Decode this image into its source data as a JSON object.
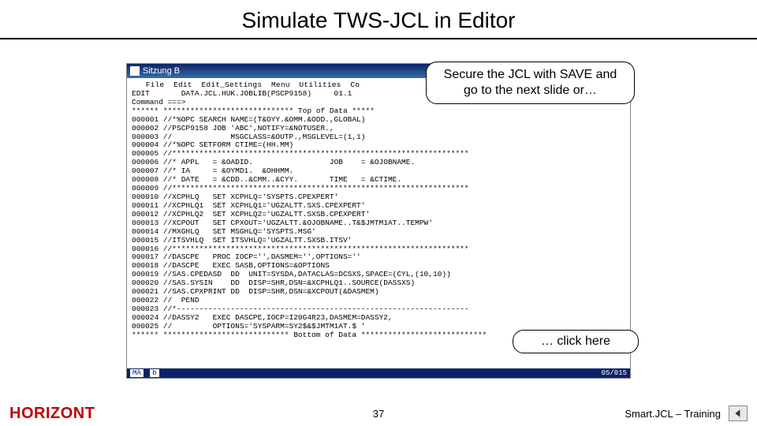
{
  "slide": {
    "title": "Simulate TWS-JCL in Editor",
    "page_number": "37",
    "brand": "HORIZONT",
    "course": "Smart.JCL – Training"
  },
  "callouts": {
    "c1": "Secure the JCL with SAVE and go to the next slide or…",
    "c2": "… click here"
  },
  "terminal": {
    "window_title": "Sitzung B",
    "menu": "   File  Edit  Edit_Settings  Menu  Utilities  Co",
    "header1": "EDIT       DATA.JCL.HUK.JOBLIB(PSCP9158)     01.1",
    "header2": "Command ===>",
    "lines": [
      "****** ***************************** Top of Data *****",
      "000001 //*%OPC SEARCH NAME=(T&OYY.&OMM.&ODD.,GLOBAL)",
      "000002 //PSCP9158 JOB 'ABC',NOTIFY=&NOTUSER.,",
      "000003 //             MSGCLASS=&OUTP.,MSGLEVEL=(1,1)",
      "000004 //*%OPC SETFORM CTIME=(HH.MM)",
      "000005 //******************************************************************",
      "000006 //* APPL   = &OADID.                 JOB    = &OJOBNAME.",
      "000007 //* IA     = &OYMD1.  &OHHMM.",
      "000008 //* DATE   = &CDD..&CMM..&CYY.       TIME   = &CTIME.",
      "000009 //******************************************************************",
      "000010 //XCPHLQ   SET XCPHLQ='SYSPTS.CPEXPERT'",
      "000011 //XCPHLQ1  SET XCPHLQ1='UGZALTT.SXS.CPEXPERT'",
      "000012 //XCPHLQ2  SET XCPHLQ2='UGZALTT.SXSB.CPEXPERT'",
      "000013 //XCPOUT   SET CPXOUT='UGZALTT.&OJOBNAME..T&$JMTM1AT..TEMPW'",
      "000014 //MXGHLQ   SET MSGHLQ='SYSPTS.MSG'",
      "000015 //ITSVHLQ  SET ITSVHLQ='UGZALTT.SXSB.ITSV'",
      "000016 //******************************************************************",
      "000017 //DASCPE   PROC IOCP='',DASMEM='',OPTIONS=''",
      "000018 //DASCPE   EXEC SASB,OPTIONS=&OPTIONS",
      "000019 //SAS.CPEDASD  DD  UNIT=SYSDA,DATACLAS=DCSXS,SPACE=(CYL,(10,10))",
      "000020 //SAS.SYSIN    DD  DISP=SHR,DSN=&XCPHLQ1..SOURCE(DASSXS)",
      "000021 //SAS.CPXPRINT DD  DISP=SHR,DSN=&XCPOUT(&DASMEM)",
      "000022 //  PEND",
      "000023 //*-----------------------------------------------------------------",
      "000024 //DASSY2   EXEC DASCPE,IOCP=I20G4R23,DASMEM=DASSY2,",
      "000025 //         OPTIONS='SYSPARM=SY2$&$JMTM1AT.$ '",
      "****** **************************** Bottom of Data ****************************"
    ],
    "status_left_1": "MA",
    "status_left_2": "b",
    "status_right": "05/015"
  }
}
